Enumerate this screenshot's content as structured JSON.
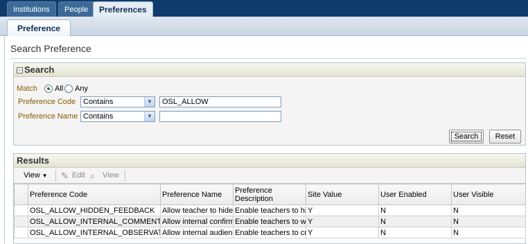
{
  "top_tabs": [
    {
      "label": "Institutions",
      "active": false
    },
    {
      "label": "People",
      "active": false
    },
    {
      "label": "Preferences",
      "active": true
    }
  ],
  "sub_tab": {
    "label": "Preference"
  },
  "page_title": "Search Preference",
  "search": {
    "header": "Search",
    "collapse_glyph": "⊟",
    "match_label": "Match",
    "match_options": [
      {
        "label": "All",
        "selected": true
      },
      {
        "label": "Any",
        "selected": false
      }
    ],
    "fields": [
      {
        "label": "Preference Code",
        "operator": "Contains",
        "value": "OSL_ALLOW"
      },
      {
        "label": "Preference Name",
        "operator": "Contains",
        "value": ""
      }
    ],
    "search_button": "Search",
    "reset_button": "Reset"
  },
  "results": {
    "header": "Results",
    "toolbar": {
      "view_menu": "View",
      "edit": "Edit",
      "view": "View"
    },
    "columns": [
      "",
      "Preference Code",
      "Preference Name",
      "Preference Description",
      "Site Value",
      "User Enabled",
      "User Visible"
    ],
    "rows": [
      [
        "",
        "OSL_ALLOW_HIDDEN_FEEDBACK",
        "Allow teacher to hide",
        "Enable teachers to hi",
        "Y",
        "N",
        "N"
      ],
      [
        "",
        "OSL_ALLOW_INTERNAL_COMMENTS",
        "Allow internal confirm",
        "Enable teachers to wr",
        "Y",
        "N",
        "N"
      ],
      [
        "",
        "OSL_ALLOW_INTERNAL_OBSERVATIONS",
        "Allow internal audienc",
        "Enable teachers to cr",
        "Y",
        "N",
        "N"
      ]
    ]
  },
  "colors": {
    "top_band": "#0f3b6c",
    "label_text": "#8a5a00",
    "panel_header": "#e3e3d3"
  }
}
